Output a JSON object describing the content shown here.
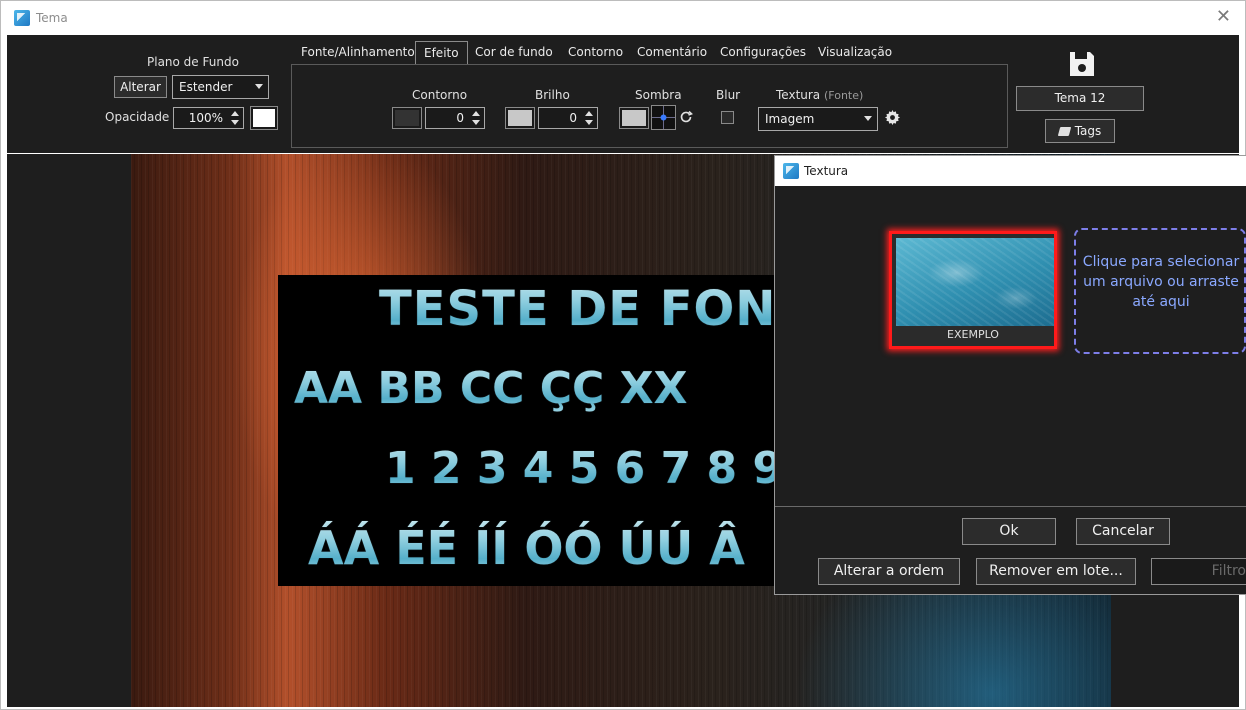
{
  "window": {
    "title": "Tema",
    "close": "✕"
  },
  "background": {
    "label": "Plano de Fundo",
    "change_button": "Alterar",
    "mode_select": "Estender",
    "opacity_label": "Opacidade",
    "opacity_value": "100%"
  },
  "tabs": [
    {
      "label": "Fonte/Alinhamento"
    },
    {
      "label": "Efeito"
    },
    {
      "label": "Cor de fundo"
    },
    {
      "label": "Contorno"
    },
    {
      "label": "Comentário"
    },
    {
      "label": "Configurações"
    },
    {
      "label": "Visualização"
    }
  ],
  "effect": {
    "outline_label": "Contorno",
    "outline_value": "0",
    "brightness_label": "Brilho",
    "brightness_value": "0",
    "shadow_label": "Sombra",
    "blur_label": "Blur",
    "texture_label": "Textura",
    "texture_sublabel": "(Fonte)",
    "texture_select": "Imagem"
  },
  "theme": {
    "name": "Tema 12",
    "tags_button": "Tags"
  },
  "preview": {
    "lines": [
      "TESTE DE FON",
      "AA BB CC ÇÇ XX",
      "1 2 3 4 5 6 7 8 9",
      "ÁÁ ÉÉ ÍÍ ÓÓ ÚÚ Â"
    ]
  },
  "dialog": {
    "title": "Textura",
    "thumb_label": "EXEMPLO",
    "drop_zone": "Clique para selecionar um arquivo ou arraste até aqui",
    "ok": "Ok",
    "cancel": "Cancelar",
    "reorder": "Alterar a ordem",
    "batch_remove": "Remover em lote...",
    "filter": "Filtro"
  },
  "colors": {
    "outline_swatch": "#333333",
    "brightness_swatch": "#c8c8c8",
    "shadow_swatch": "#c8c8c8",
    "bg_color_swatch": "#ffffff",
    "selection_border": "#ff1a1a",
    "drop_zone_border": "#7d7ee8"
  },
  "icons": {
    "save": "floppy-disk-icon",
    "tags": "tag-icon",
    "settings": "gear-icon",
    "reset": "refresh-icon"
  }
}
